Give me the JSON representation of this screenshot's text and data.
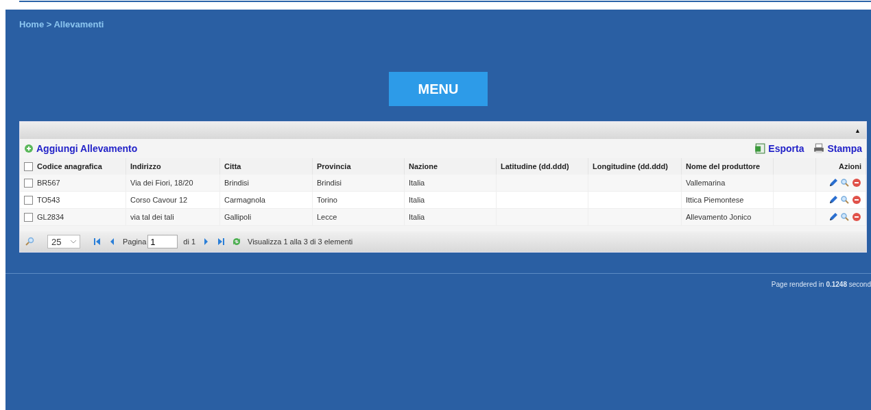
{
  "breadcrumb": "Home > Allevamenti",
  "menu_button": "MENU",
  "panel": {
    "collapse_icon": "▲",
    "add_link": "Aggiungi Allevamento",
    "export_link": "Esporta",
    "print_link": "Stampa",
    "header_checked": false,
    "columns": [
      "Codice anagrafica",
      "Indirizzo",
      "Citta",
      "Provincia",
      "Nazione",
      "Latitudine (dd.ddd)",
      "Longitudine (dd.ddd)",
      "Nome del produttore",
      "",
      "Azioni"
    ],
    "rows": [
      {
        "checked": false,
        "cells": [
          "BR567",
          "Via dei Fiori, 18/20",
          "Brindisi",
          "Brindisi",
          "Italia",
          "",
          "",
          "Vallemarina"
        ]
      },
      {
        "checked": false,
        "cells": [
          "TO543",
          "Corso Cavour 12",
          "Carmagnola",
          "Torino",
          "Italia",
          "",
          "",
          "Ittica Piemontese"
        ]
      },
      {
        "checked": false,
        "cells": [
          "GL2834",
          "via tal dei tali",
          "Gallipoli",
          "Lecce",
          "Italia",
          "",
          "",
          "Allevamento Jonico"
        ]
      }
    ],
    "pager": {
      "page_size": "25",
      "page_label": "Pagina",
      "page": "1",
      "of_label": "di 1",
      "summary": "Visualizza 1 alla 3 di 3 elementi"
    }
  },
  "footer": "Page rendered in **0.1248** second"
}
